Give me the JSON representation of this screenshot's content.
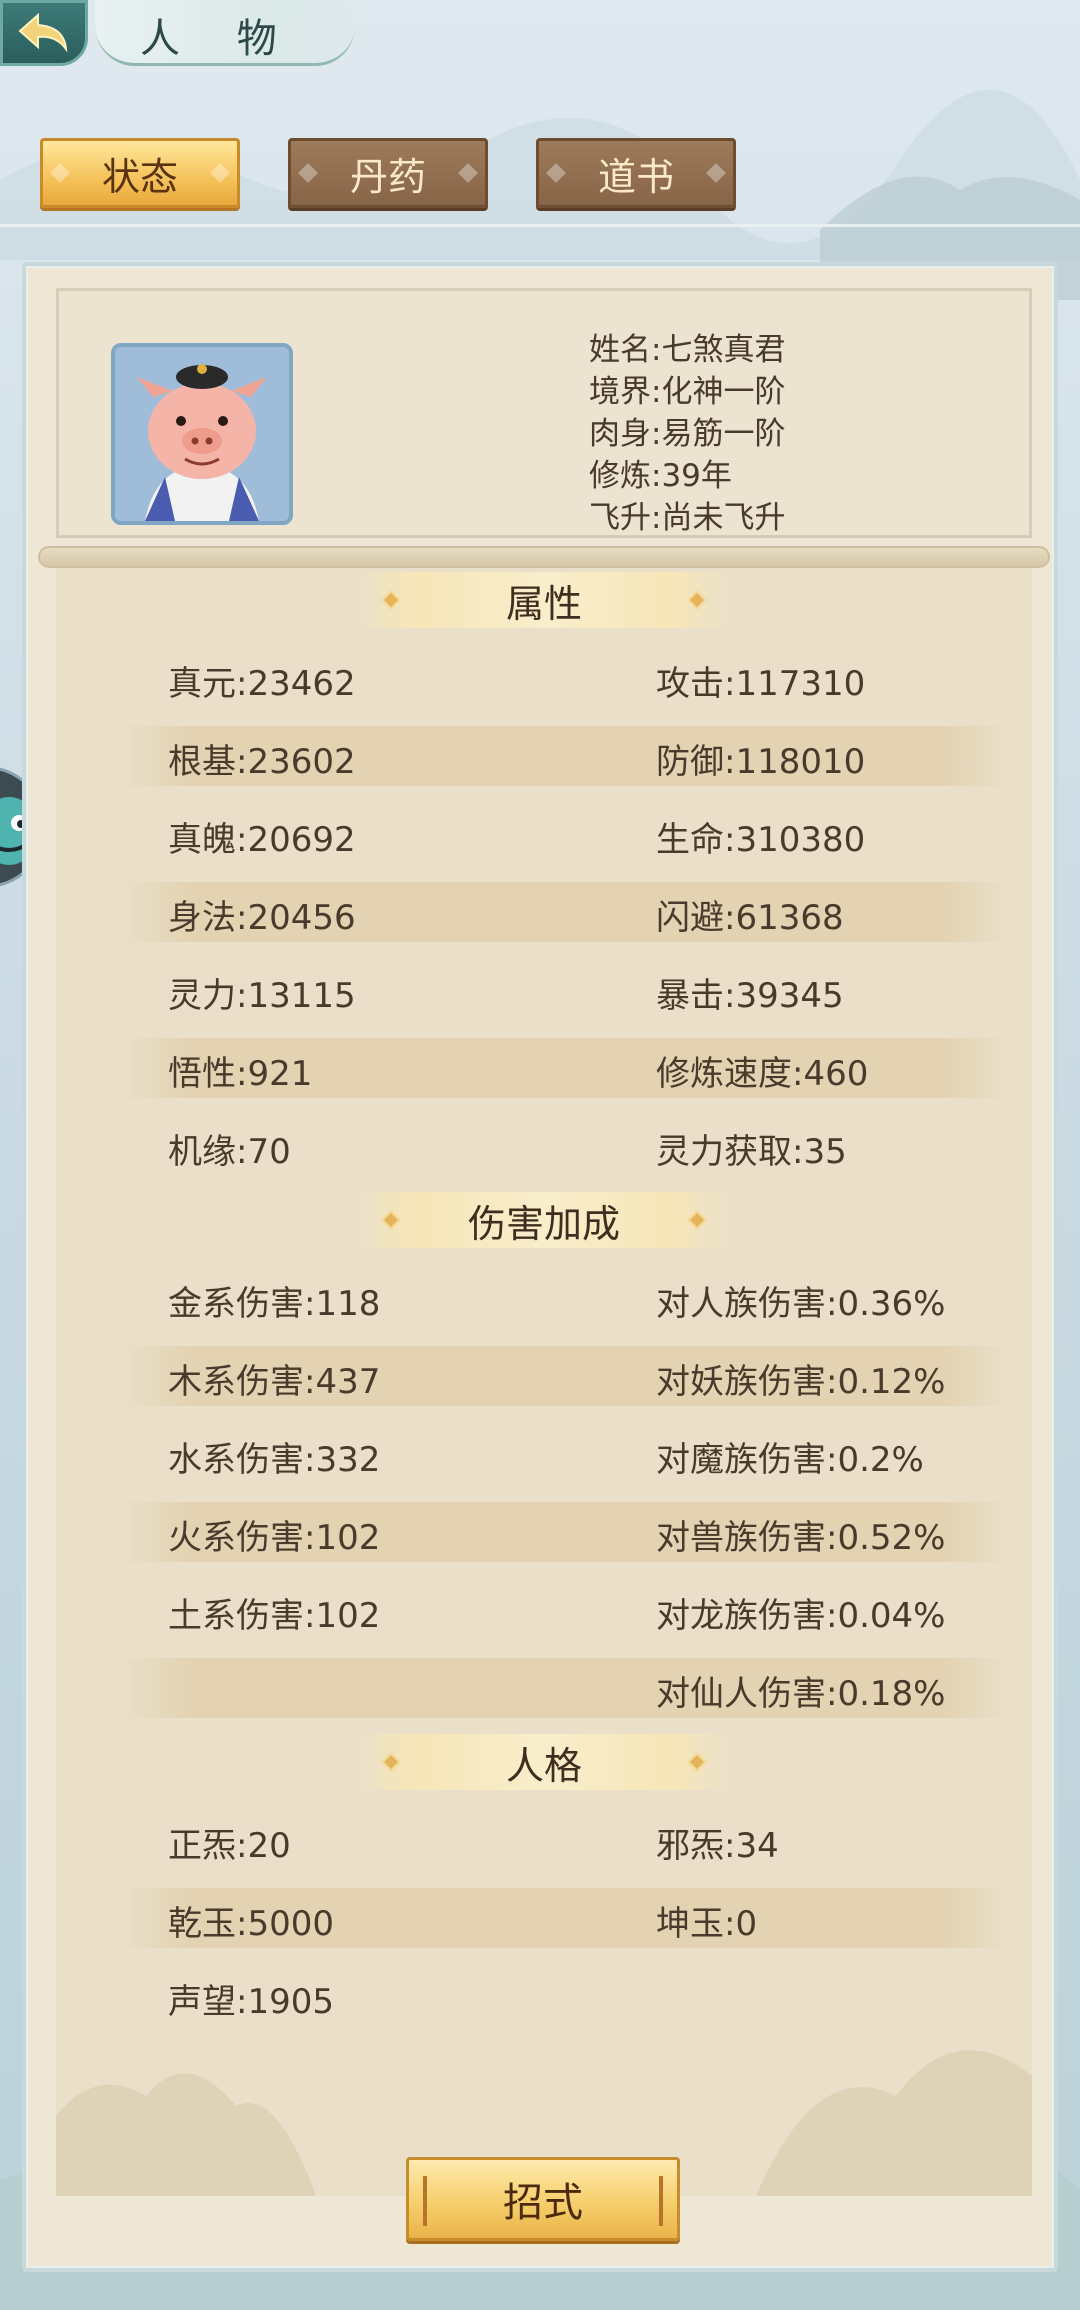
{
  "header": {
    "title": "人 物"
  },
  "tabs": [
    {
      "label": "状态",
      "active": true
    },
    {
      "label": "丹药",
      "active": false
    },
    {
      "label": "道书",
      "active": false
    }
  ],
  "profile": {
    "lines": [
      "姓名:七煞真君",
      "境界:化神一阶",
      "肉身:易筋一阶",
      "修炼:39年",
      "飞升:尚未飞升"
    ]
  },
  "sections": {
    "attributes": {
      "title": "属性",
      "rows": [
        [
          "真元:23462",
          "攻击:117310"
        ],
        [
          "根基:23602",
          "防御:118010"
        ],
        [
          "真魄:20692",
          "生命:310380"
        ],
        [
          "身法:20456",
          "闪避:61368"
        ],
        [
          "灵力:13115",
          "暴击:39345"
        ],
        [
          "悟性:921",
          "修炼速度:460"
        ],
        [
          "机缘:70",
          "灵力获取:35"
        ]
      ]
    },
    "damage": {
      "title": "伤害加成",
      "rows": [
        [
          "金系伤害:118",
          "对人族伤害:0.36%"
        ],
        [
          "木系伤害:437",
          "对妖族伤害:0.12%"
        ],
        [
          "水系伤害:332",
          "对魔族伤害:0.2%"
        ],
        [
          "火系伤害:102",
          "对兽族伤害:0.52%"
        ],
        [
          "土系伤害:102",
          "对龙族伤害:0.04%"
        ],
        [
          "",
          "对仙人伤害:0.18%"
        ]
      ]
    },
    "personality": {
      "title": "人格",
      "rows": [
        [
          "正炁:20",
          "邪炁:34"
        ],
        [
          "乾玉:5000",
          "坤玉:0"
        ],
        [
          "声望:1905",
          ""
        ]
      ]
    }
  },
  "footer": {
    "skill_button": "招式"
  },
  "colors": {
    "panel_bg": "#efe7d6",
    "tab_active": "#f5c25a",
    "tab_inactive": "#876547",
    "accent_teal": "#2a5d5c"
  }
}
